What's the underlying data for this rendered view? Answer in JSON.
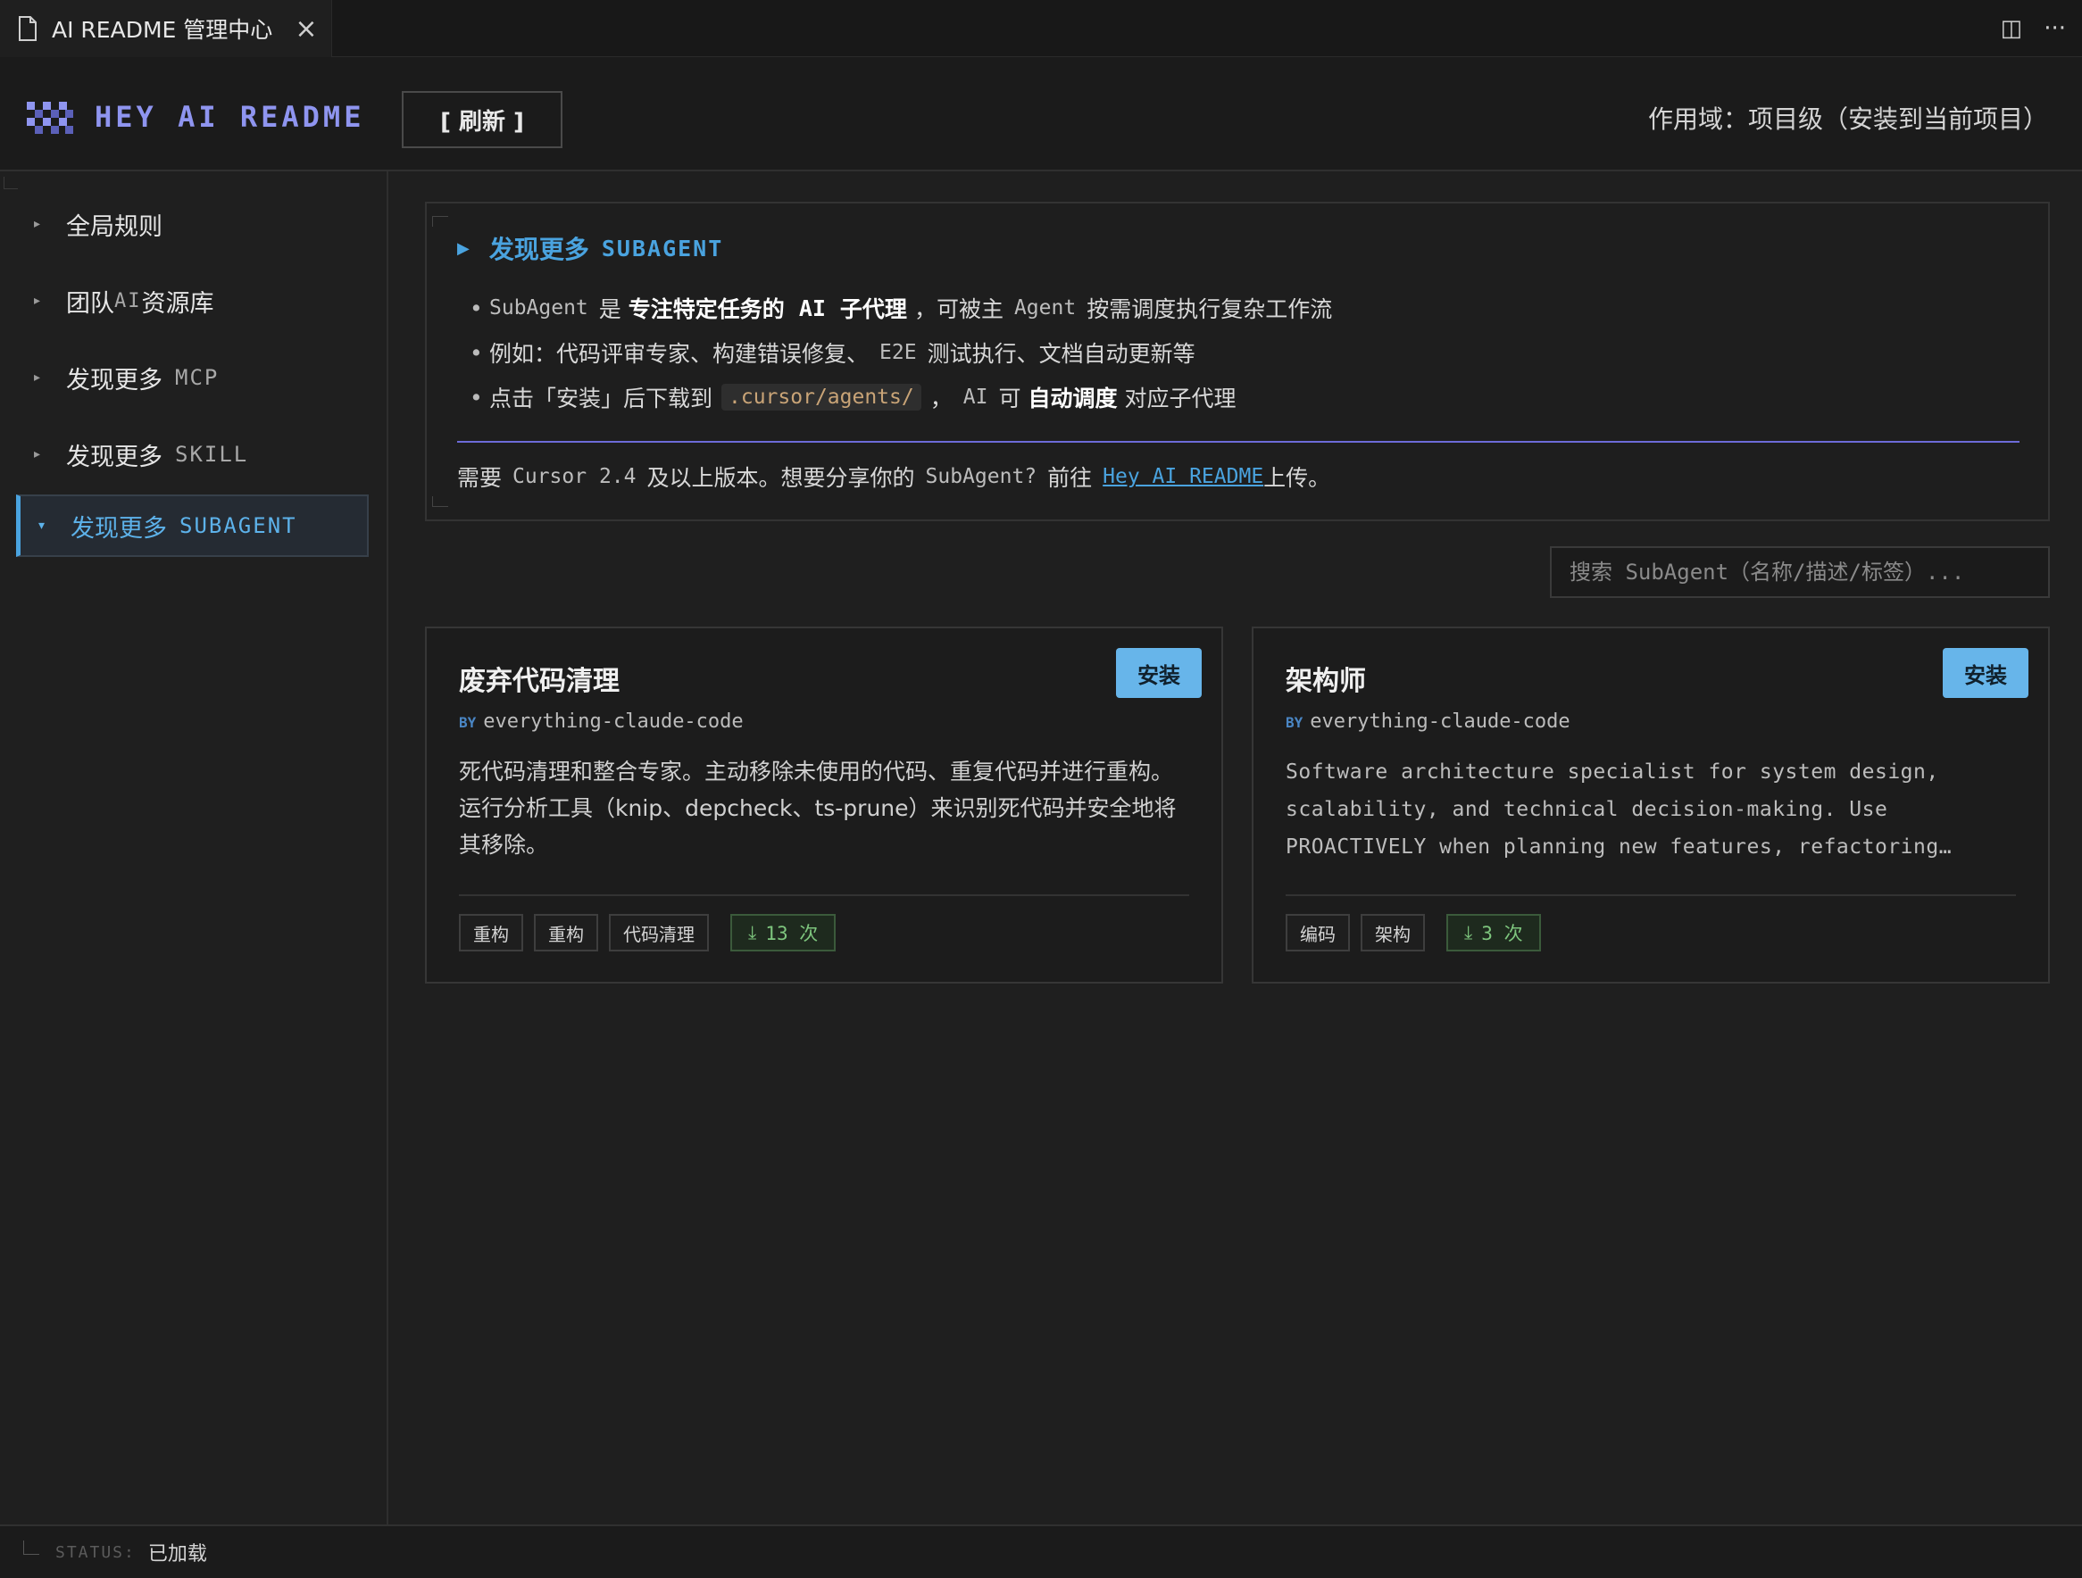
{
  "tab": {
    "title": "AI README 管理中心",
    "close": "×"
  },
  "tabbar_actions": {
    "split": "◫",
    "more": "···"
  },
  "header": {
    "brand": "HEY AI README",
    "refresh_label": "[ 刷新 ]",
    "scope": "作用域：项目级（安装到当前项目）"
  },
  "sidebar": {
    "items": [
      {
        "label": "全局规则",
        "mono": "",
        "active": false
      },
      {
        "label": "团队",
        "mono": "AI",
        "label_after": "资源库",
        "active": false
      },
      {
        "label": "发现更多",
        "mono": "MCP",
        "active": false
      },
      {
        "label": "发现更多",
        "mono": "SKILL",
        "active": false
      },
      {
        "label": "发现更多",
        "mono": "SUBAGENT",
        "active": true
      }
    ]
  },
  "info": {
    "title": "发现更多",
    "title_mono": "SUBAGENT",
    "bullet1": {
      "a": "SubAgent",
      "b": "是",
      "c": "专注特定任务的",
      "d": "AI",
      "e": "子代理",
      "f": "，可被主",
      "g": "Agent",
      "h": "按需调度执行复杂工作流"
    },
    "bullet2": {
      "a": "例如：代码评审专家、构建错误修复、",
      "b": "E2E",
      "c": "测试执行、文档自动更新等"
    },
    "bullet3": {
      "a": "点击「安装」后下载到",
      "b": ".cursor/agents/",
      "c": "，",
      "d": "AI",
      "e": "可",
      "f": "自动调度",
      "g": "对应子代理"
    },
    "note": {
      "a": "需要",
      "b": "Cursor 2.4",
      "c": "及以上版本。想要分享你的",
      "d": "SubAgent?",
      "e": "前往",
      "link": "Hey AI README ",
      "f": "上传。"
    }
  },
  "search": {
    "placeholder": "搜索 SubAgent（名称/描述/标签）..."
  },
  "cards": [
    {
      "title": "废弃代码清理",
      "install": "安装",
      "by": "BY",
      "author": "everything-claude-code",
      "description": "死代码清理和整合专家。主动移除未使用的代码、重复代码并进行重构。运行分析工具（knip、depcheck、ts-prune）来识别死代码并安全地将其移除。",
      "tags": [
        "重构",
        "重构",
        "代码清理"
      ],
      "downloads": "13 次"
    },
    {
      "title": "架构师",
      "install": "安装",
      "by": "BY",
      "author": "everything-claude-code",
      "description": "Software architecture specialist for system design, scalability, and technical decision-making. Use PROACTIVELY when planning new features, refactoring…",
      "tags": [
        "编码",
        "架构"
      ],
      "downloads": "3 次"
    }
  ],
  "status": {
    "label": "STATUS:",
    "value": "已加载"
  },
  "colors": {
    "accent": "#4aa3df",
    "brand": "#8f95f0",
    "install_bg": "#67b5ea",
    "download_green": "#7ec67e",
    "divider_purple": "#6d6bd8"
  }
}
